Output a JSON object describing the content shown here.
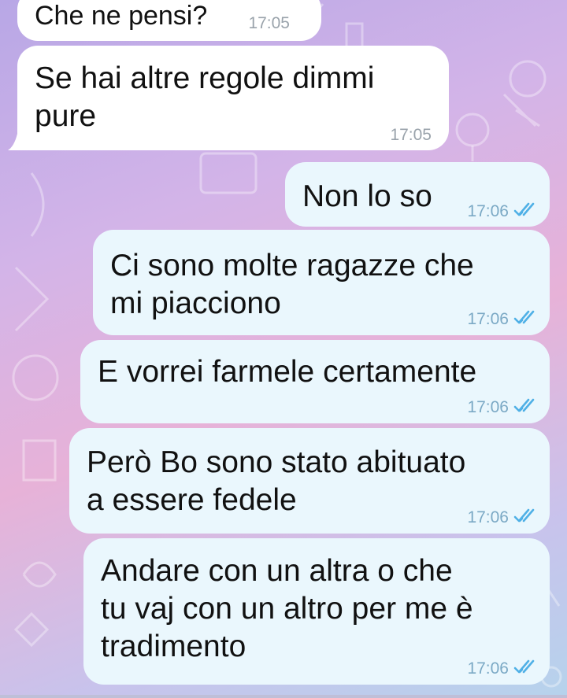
{
  "messages": [
    {
      "direction": "in",
      "text": "Che ne pensi?",
      "time": "17:05"
    },
    {
      "direction": "in",
      "text": "Se hai altre regole dimmi\npure",
      "time": "17:05"
    },
    {
      "direction": "out",
      "text": "Non lo so",
      "time": "17:06",
      "status": "double-check-read-icon"
    },
    {
      "direction": "out",
      "text": "Ci sono molte ragazze che\nmi piacciono",
      "time": "17:06",
      "status": "double-check-read-icon"
    },
    {
      "direction": "out",
      "text": "E vorrei farmele certamente",
      "time": "17:06",
      "status": "double-check-read-icon"
    },
    {
      "direction": "out",
      "text": "Però Bo sono stato abituato\na essere fedele",
      "time": "17:06",
      "status": "double-check-read-icon"
    },
    {
      "direction": "out",
      "text": "Andare con un altra o che\ntu vaj con un altro per me è\ntradimento",
      "time": "17:06",
      "status": "double-check-read-icon"
    }
  ],
  "colors": {
    "incoming_bubble": "#ffffff",
    "outgoing_bubble": "#eaf7fd",
    "read_check": "#4fb0e6"
  }
}
